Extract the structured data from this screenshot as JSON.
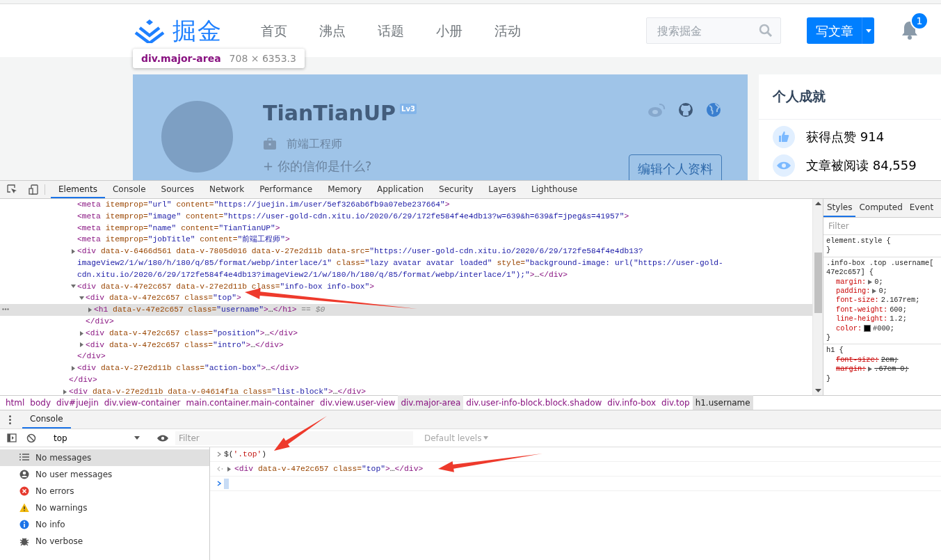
{
  "site": {
    "logo": {
      "text": "掘金"
    },
    "nav": [
      {
        "label": "首页"
      },
      {
        "label": "沸点"
      },
      {
        "label": "话题"
      },
      {
        "label": "小册"
      },
      {
        "label": "活动"
      }
    ],
    "search": {
      "placeholder": "搜索掘金"
    },
    "write_button": {
      "label": "写文章"
    },
    "notifications": {
      "count": "1"
    },
    "inspect_tooltip": {
      "selector": "div.major-area",
      "size": "708 × 6353.3"
    },
    "profile": {
      "highlighted": true,
      "username": "TianTianUP",
      "level": "Lv3",
      "job": "前端工程师",
      "intro": "+ 你的信仰是什么?",
      "edit_button": "编辑个人资料"
    },
    "achievements": {
      "title": "个人成就",
      "items": [
        {
          "kind": "likes",
          "text": "获得点赞 914"
        },
        {
          "kind": "reads",
          "text": "文章被阅读 84,559"
        }
      ]
    }
  },
  "devtools": {
    "tabs": [
      {
        "label": "Elements",
        "selected": true
      },
      {
        "label": "Console",
        "selected": false
      },
      {
        "label": "Sources",
        "selected": false
      },
      {
        "label": "Network",
        "selected": false
      },
      {
        "label": "Performance",
        "selected": false
      },
      {
        "label": "Memory",
        "selected": false
      },
      {
        "label": "Application",
        "selected": false
      },
      {
        "label": "Security",
        "selected": false
      },
      {
        "label": "Layers",
        "selected": false
      },
      {
        "label": "Lighthouse",
        "selected": false
      }
    ],
    "elements": {
      "nodes": [
        {
          "children": [
            {
              "segments": [
                {
                  "kind": "tag",
                  "text": "<meta"
                },
                {
                  "kind": "attr",
                  "text": " itemprop="
                },
                {
                  "kind": "value",
                  "text": "\"url\""
                },
                {
                  "kind": "attr",
                  "text": " content="
                },
                {
                  "kind": "value",
                  "text": "\"https://juejin.im/user/5ef326ab6fb9a07ebe237664\""
                },
                {
                  "kind": "tag",
                  "text": ">"
                }
              ],
              "expandable": false,
              "selected": false
            },
            {
              "segments": [
                {
                  "kind": "tag",
                  "text": "<meta"
                },
                {
                  "kind": "attr",
                  "text": " itemprop="
                },
                {
                  "kind": "value",
                  "text": "\"image\""
                },
                {
                  "kind": "attr",
                  "text": " content="
                },
                {
                  "kind": "value",
                  "text": "\"https://user-gold-cdn.xitu.io/2020/6/29/172fe584f4e4db13?w=639&h=639&f=jpeg&s=41957\""
                },
                {
                  "kind": "tag",
                  "text": ">"
                }
              ],
              "expandable": false,
              "selected": false
            },
            {
              "segments": [
                {
                  "kind": "tag",
                  "text": "<meta"
                },
                {
                  "kind": "attr",
                  "text": " itemprop="
                },
                {
                  "kind": "value",
                  "text": "\"name\""
                },
                {
                  "kind": "attr",
                  "text": " content="
                },
                {
                  "kind": "value",
                  "text": "\"TianTianUP\""
                },
                {
                  "kind": "tag",
                  "text": ">"
                }
              ],
              "expandable": false,
              "selected": false
            },
            {
              "segments": [
                {
                  "kind": "tag",
                  "text": "<meta"
                },
                {
                  "kind": "attr",
                  "text": " itemprop="
                },
                {
                  "kind": "value",
                  "text": "\"jobTitle\""
                },
                {
                  "kind": "attr",
                  "text": " content="
                },
                {
                  "kind": "value",
                  "text": "\"前端工程师\""
                },
                {
                  "kind": "tag",
                  "text": ">"
                }
              ],
              "expandable": false,
              "selected": false
            },
            {
              "segments": [
                {
                  "kind": "tag",
                  "text": "<div"
                },
                {
                  "kind": "attr",
                  "text": " data-v-6466d561 data-v-7805d016 data-v-27e2d11b data-src="
                },
                {
                  "kind": "value",
                  "text": "\"https://user-gold-cdn.xitu.io/2020/6/29/172fe584f4e4db13?imageView2/1/w/180/h/180/q/85/format/webp/interlace/1\""
                },
                {
                  "kind": "attr",
                  "text": " class="
                },
                {
                  "kind": "value",
                  "text": "\"lazy avatar avatar loaded\""
                },
                {
                  "kind": "attr",
                  "text": " style="
                },
                {
                  "kind": "value",
                  "text": "\"background-image: url(\"https://user-gold-cdn.xitu.io/2020/6/29/172fe584f4e4db13?imageView2/1/w/180/h/180/q/85/format/webp/interlace/1\");\""
                },
                {
                  "kind": "tag",
                  "text": ">"
                },
                {
                  "kind": "text",
                  "text": "…"
                },
                {
                  "kind": "tag",
                  "text": "</div>"
                }
              ],
              "expandable": true,
              "expanded": false,
              "selected": false
            },
            {
              "segments": [
                {
                  "kind": "tag",
                  "text": "<div"
                },
                {
                  "kind": "attr",
                  "text": " data-v-47e2c657 data-v-27e2d11b class="
                },
                {
                  "kind": "value",
                  "text": "\"info-box info-box\""
                },
                {
                  "kind": "tag",
                  "text": ">"
                }
              ],
              "expandable": true,
              "expanded": true,
              "selected": false,
              "children": [
                {
                  "segments": [
                    {
                      "kind": "tag",
                      "text": "<div"
                    },
                    {
                      "kind": "attr",
                      "text": " data-v-47e2c657 class="
                    },
                    {
                      "kind": "value",
                      "text": "\"top\""
                    },
                    {
                      "kind": "tag",
                      "text": ">"
                    }
                  ],
                  "expandable": true,
                  "expanded": true,
                  "selected": false,
                  "children": [
                    {
                      "segments": [
                        {
                          "kind": "tag",
                          "text": "<h1"
                        },
                        {
                          "kind": "attr",
                          "text": " data-v-47e2c657 class="
                        },
                        {
                          "kind": "value",
                          "text": "\"username\""
                        },
                        {
                          "kind": "tag",
                          "text": ">"
                        },
                        {
                          "kind": "text",
                          "text": "…"
                        },
                        {
                          "kind": "tag",
                          "text": "</h1>"
                        },
                        {
                          "kind": "ref",
                          "text": " == $0"
                        }
                      ],
                      "expandable": true,
                      "expanded": false,
                      "selected": true
                    }
                  ],
                  "close": [
                    {
                      "kind": "tag",
                      "text": "</div>"
                    }
                  ]
                },
                {
                  "segments": [
                    {
                      "kind": "tag",
                      "text": "<div"
                    },
                    {
                      "kind": "attr",
                      "text": " data-v-47e2c657 class="
                    },
                    {
                      "kind": "value",
                      "text": "\"position\""
                    },
                    {
                      "kind": "tag",
                      "text": ">"
                    },
                    {
                      "kind": "text",
                      "text": "…"
                    },
                    {
                      "kind": "tag",
                      "text": "</div>"
                    }
                  ],
                  "expandable": true,
                  "expanded": false,
                  "selected": false
                },
                {
                  "segments": [
                    {
                      "kind": "tag",
                      "text": "<div"
                    },
                    {
                      "kind": "attr",
                      "text": " data-v-47e2c657 class="
                    },
                    {
                      "kind": "value",
                      "text": "\"intro\""
                    },
                    {
                      "kind": "tag",
                      "text": ">"
                    },
                    {
                      "kind": "text",
                      "text": "…"
                    },
                    {
                      "kind": "tag",
                      "text": "</div>"
                    }
                  ],
                  "expandable": true,
                  "expanded": false,
                  "selected": false
                }
              ],
              "close": [
                {
                  "kind": "tag",
                  "text": "</div>"
                }
              ]
            },
            {
              "segments": [
                {
                  "kind": "tag",
                  "text": "<div"
                },
                {
                  "kind": "attr",
                  "text": " data-v-27e2d11b class="
                },
                {
                  "kind": "value",
                  "text": "\"action-box\""
                },
                {
                  "kind": "tag",
                  "text": ">"
                },
                {
                  "kind": "text",
                  "text": "…"
                },
                {
                  "kind": "tag",
                  "text": "</div>"
                }
              ],
              "expandable": true,
              "expanded": false,
              "selected": false
            }
          ],
          "close": [
            {
              "kind": "tag",
              "text": "</div>"
            }
          ]
        },
        {
          "segments": [
            {
              "kind": "tag",
              "text": "<div"
            },
            {
              "kind": "attr",
              "text": " data-v-27e2d11b data-v-04614f1a class="
            },
            {
              "kind": "value",
              "text": "\"list-block\""
            },
            {
              "kind": "tag",
              "text": ">"
            },
            {
              "kind": "text",
              "text": "…"
            },
            {
              "kind": "tag",
              "text": "</div>"
            }
          ],
          "expandable": true,
          "expanded": false,
          "selected": false
        }
      ]
    },
    "styles": {
      "tabs": [
        {
          "label": "Styles",
          "selected": true
        },
        {
          "label": "Computed",
          "selected": false
        },
        {
          "label": "Event",
          "selected": false
        }
      ],
      "filter_placeholder": "Filter",
      "rules": [
        {
          "selector_lines": [
            "element.style {"
          ],
          "close": "}"
        },
        {
          "selector_lines": [
            ".info-box .top .username[",
            "47e2c657] {"
          ],
          "properties": [
            {
              "name": "margin:",
              "expander": true,
              "value": "0;",
              "overridden": false
            },
            {
              "name": "padding:",
              "expander": true,
              "value": "0;",
              "overridden": false
            },
            {
              "name": "font-size:",
              "expander": false,
              "value": "2.167rem;",
              "overridden": false
            },
            {
              "name": "font-weight:",
              "expander": false,
              "value": "600;",
              "overridden": false
            },
            {
              "name": "line-height:",
              "expander": false,
              "value": "1.2;",
              "overridden": false
            },
            {
              "name": "color:",
              "expander": false,
              "swatch": true,
              "value": "#000;",
              "overridden": false
            }
          ],
          "close": "}"
        },
        {
          "selector_lines": [
            "h1 {"
          ],
          "properties": [
            {
              "name": "font-size:",
              "expander": false,
              "value": "2em;",
              "overridden": true
            },
            {
              "name": "margin:",
              "expander": true,
              "value": ".67em 0;",
              "overridden": true
            }
          ],
          "close": "}"
        }
      ]
    },
    "breadcrumbs": [
      {
        "label": "html",
        "selected": false,
        "hovered": false
      },
      {
        "label": "body",
        "selected": false,
        "hovered": false
      },
      {
        "label": "div#juejin",
        "selected": false,
        "hovered": false
      },
      {
        "label": "div.view-container",
        "selected": false,
        "hovered": false
      },
      {
        "label": "main.container.main-container",
        "selected": false,
        "hovered": false
      },
      {
        "label": "div.view.user-view",
        "selected": false,
        "hovered": false
      },
      {
        "label": "div.major-area",
        "selected": false,
        "hovered": true
      },
      {
        "label": "div.user-info-block.block.shadow",
        "selected": false,
        "hovered": false
      },
      {
        "label": "div.info-box",
        "selected": false,
        "hovered": false
      },
      {
        "label": "div.top",
        "selected": false,
        "hovered": false
      },
      {
        "label": "h1.username",
        "selected": true,
        "hovered": false
      }
    ],
    "console": {
      "drawer_tabs": [
        {
          "label": "Console",
          "selected": true
        }
      ],
      "context": "top",
      "filter_placeholder": "Filter",
      "levels": "Default levels",
      "sidebar": [
        {
          "kind": "messages",
          "label": "No messages",
          "selected": true
        },
        {
          "kind": "user",
          "label": "No user messages",
          "selected": false
        },
        {
          "kind": "errors",
          "label": "No errors",
          "selected": false
        },
        {
          "kind": "warnings",
          "label": "No warnings",
          "selected": false
        },
        {
          "kind": "info",
          "label": "No info",
          "selected": false
        },
        {
          "kind": "verbose",
          "label": "No verbose",
          "selected": false
        }
      ],
      "lines": [
        {
          "kind": "input",
          "segments": [
            {
              "kind": "text",
              "text": "$("
            },
            {
              "kind": "string",
              "text": "'.top'"
            },
            {
              "kind": "text",
              "text": ")"
            }
          ]
        },
        {
          "kind": "output",
          "expanded": false,
          "segments": [
            {
              "kind": "tag",
              "text": "<div"
            },
            {
              "kind": "attr",
              "text": " data-v-47e2c657 class="
            },
            {
              "kind": "value",
              "text": "\"top\""
            },
            {
              "kind": "tag",
              "text": ">"
            },
            {
              "kind": "text",
              "text": "…"
            },
            {
              "kind": "tag",
              "text": "</div>"
            }
          ]
        },
        {
          "kind": "prompt"
        }
      ]
    }
  }
}
